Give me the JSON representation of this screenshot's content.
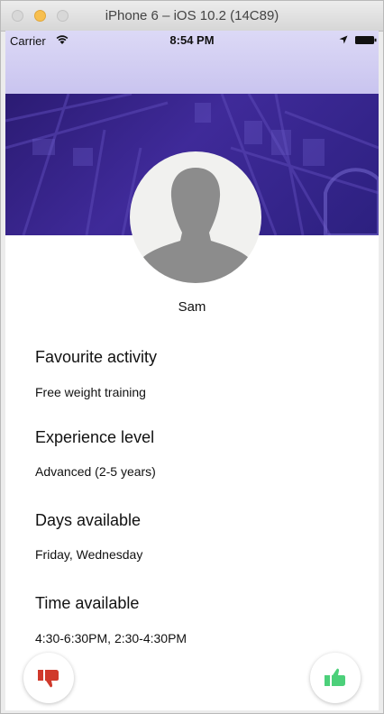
{
  "window": {
    "title": "iPhone 6 – iOS 10.2 (14C89)"
  },
  "statusbar": {
    "carrier": "Carrier",
    "time": "8:54 PM",
    "icons": [
      "wifi-icon",
      "location-icon",
      "battery-icon"
    ]
  },
  "profile": {
    "name": "Sam",
    "sections": [
      {
        "title": "Favourite activity",
        "value": "Free weight training"
      },
      {
        "title": "Experience level",
        "value": "Advanced (2-5 years)"
      },
      {
        "title": "Days available",
        "value": "Friday, Wednesday"
      },
      {
        "title": "Time available",
        "value": "4:30-6:30PM, 2:30-4:30PM"
      }
    ]
  },
  "actions": {
    "dislike_icon": "thumbs-down-icon",
    "like_icon": "thumbs-up-icon",
    "dislike_color": "#d0392b",
    "like_color": "#4cd07a"
  },
  "colors": {
    "banner": "#3a2890",
    "status_bar": "#cfcaf2"
  }
}
